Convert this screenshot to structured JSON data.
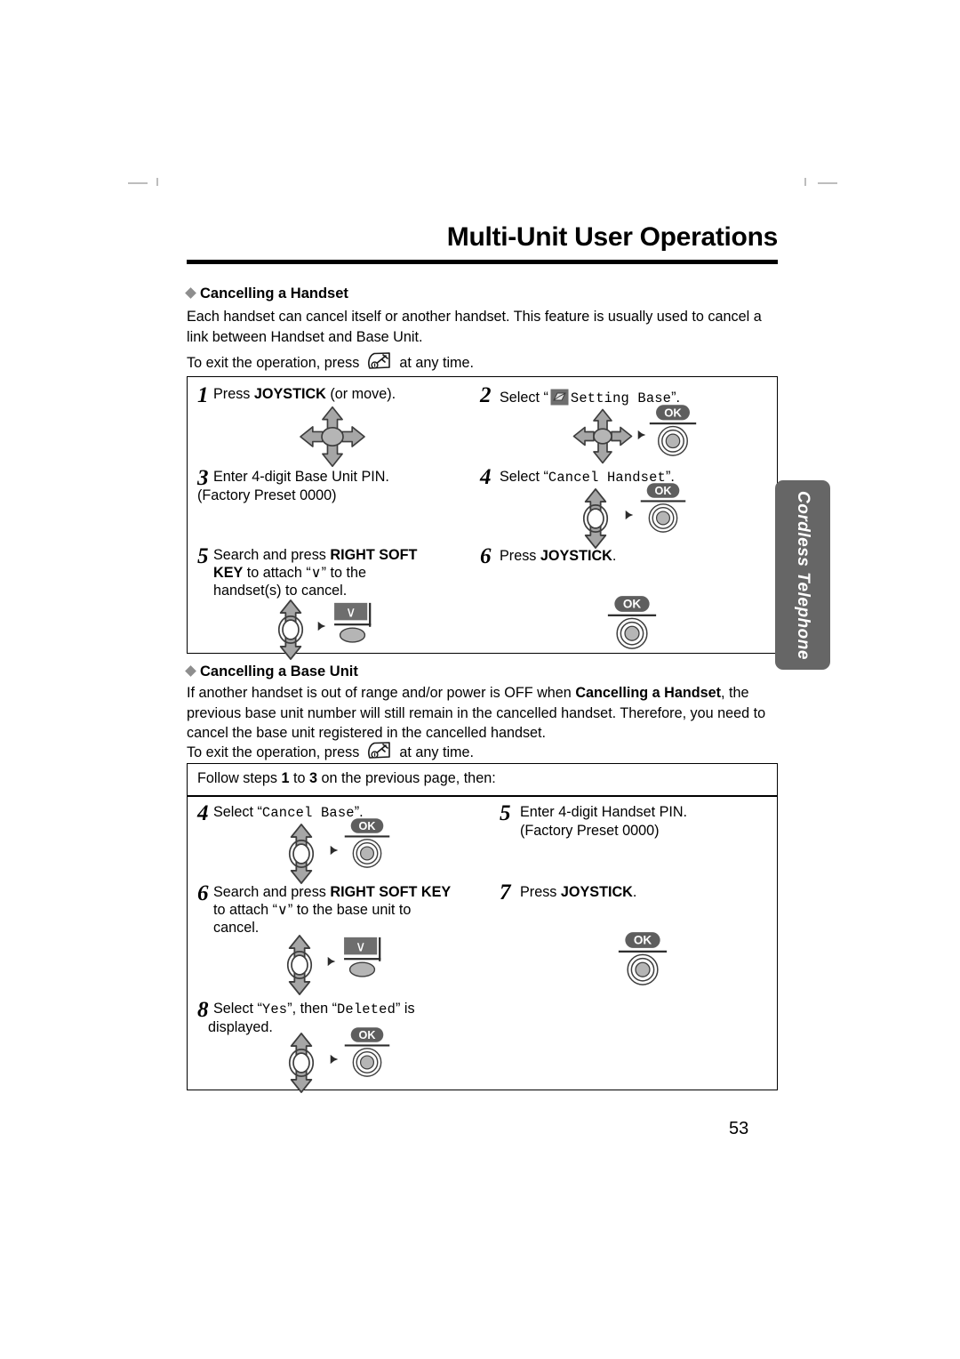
{
  "document": {
    "page_title": "Multi-Unit User Operations",
    "page_number": "53",
    "side_tab": "Cordless Telephone"
  },
  "section1": {
    "heading": "Cancelling a Handset",
    "para1": "Each handset can cancel itself or another handset. This feature is usually used to cancel a link between Handset and Base Unit.",
    "exit_prefix": "To exit the operation, press",
    "exit_suffix": "at any time.",
    "steps": [
      {
        "num": "1",
        "text_html": "Press <b>JOYSTICK</b> (or move).",
        "icon": "joystick-4way"
      },
      {
        "num": "2",
        "text_pre": "Select “",
        "text_mono": "Setting Base",
        "text_post": "”.",
        "icon": "joystick-4way-ok"
      },
      {
        "num": "3",
        "line1": "Enter 4-digit Base Unit PIN.",
        "line2": "(Factory Preset 0000)",
        "icon": "none"
      },
      {
        "num": "4",
        "text_pre": "Select “",
        "text_mono": "Cancel Handset",
        "text_post": "”.",
        "icon": "joystick-vert-ok"
      },
      {
        "num": "5",
        "line1_html": "Search and press <b>RIGHT SOFT</b>",
        "line2_html": "<b>KEY</b> to attach “∨” to the",
        "line3_html": "handset(s) to cancel.",
        "icon": "joystick-vert-softkey"
      },
      {
        "num": "6",
        "text_html": "Press <b>JOYSTICK</b>.",
        "icon": "ok-only"
      }
    ]
  },
  "section2": {
    "heading": "Cancelling a Base Unit",
    "para1_pre": "If another handset is out of range and/or power is OFF when ",
    "para1_bold": "Cancelling a Handset",
    "para1_post": ", the previous base unit number will still remain in the cancelled handset. Therefore, you need to cancel the base unit registered in the cancelled handset.",
    "exit_prefix": "To exit the operation, press",
    "exit_suffix": "at any time.",
    "follow_note_pre": "Follow steps ",
    "follow_note_n1": "1",
    "follow_note_mid": " to ",
    "follow_note_n2": "3",
    "follow_note_post": " on the previous page, then:",
    "steps": [
      {
        "num": "4",
        "text_pre": "Select “",
        "text_mono": "Cancel Base",
        "text_post": "”.",
        "icon": "joystick-vert-ok"
      },
      {
        "num": "5",
        "line1": "Enter 4-digit Handset PIN.",
        "line2": "(Factory Preset 0000)",
        "icon": "none"
      },
      {
        "num": "6",
        "line1_html": "Search and press <b>RIGHT SOFT KEY</b>",
        "line2_html": "to attach “∨” to the base unit to",
        "line3_html": "cancel.",
        "icon": "joystick-vert-softkey"
      },
      {
        "num": "7",
        "text_html": "Press <b>JOYSTICK</b>.",
        "icon": "ok-only"
      },
      {
        "num": "8",
        "text_pre": "Select “",
        "text_mono": "Yes",
        "text_mid": "”, then “",
        "text_mono2": "Deleted",
        "text_post": "” is",
        "line2": "displayed.",
        "icon": "joystick-vert-ok"
      }
    ]
  },
  "icons": {
    "joystick_4way": "joystick-4way-icon",
    "joystick_vertical": "joystick-vertical-icon",
    "ok_button": "ok-button-icon",
    "soft_key": "right-soft-key-icon",
    "exit_key": "exit-key-icon",
    "display_icon": "setting-base-display-icon",
    "arrow_right": "arrow-right-icon"
  },
  "colors": {
    "tab_gray": "#666666",
    "icon_gray": "#9a9a9a",
    "icon_dark": "#595959",
    "diamond_gray": "#8e8e8e"
  }
}
